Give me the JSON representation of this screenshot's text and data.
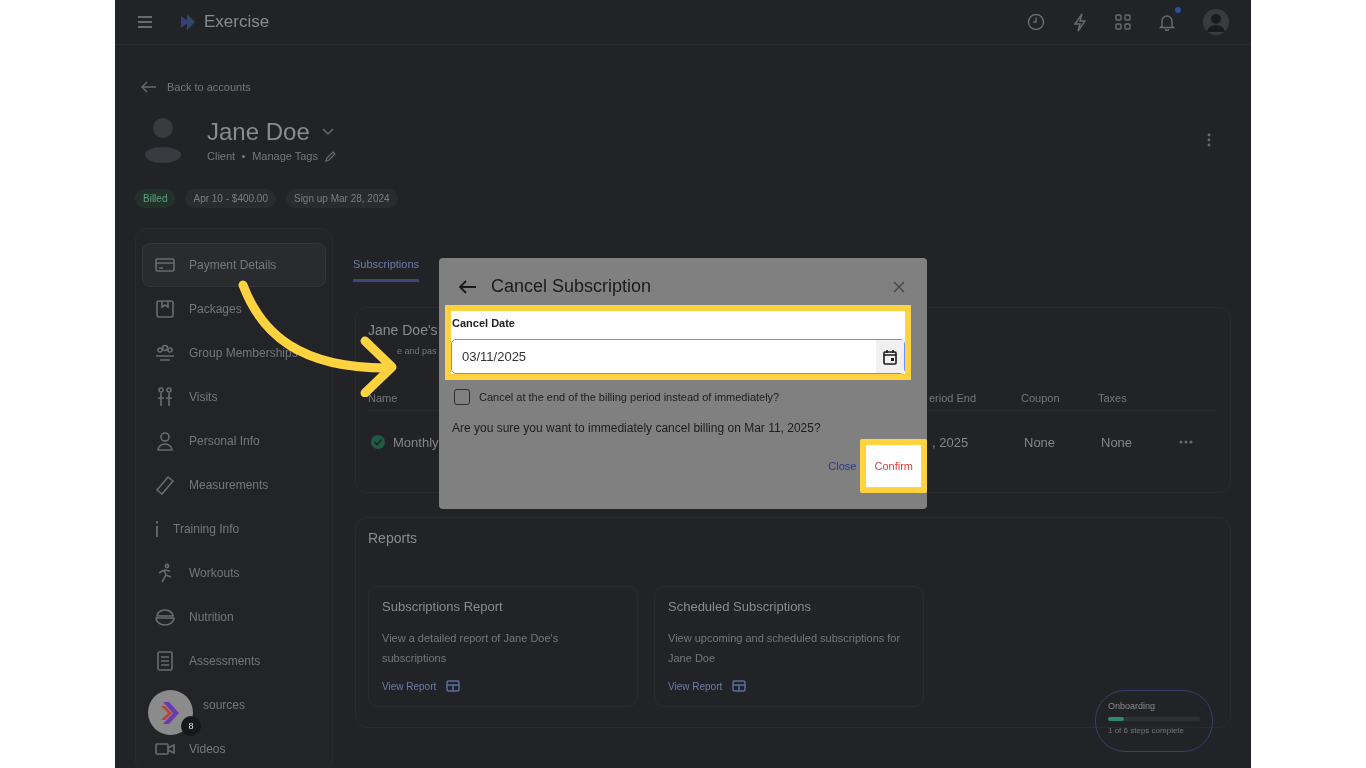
{
  "topbar": {
    "app_name": "Exercise",
    "unread_notifications": true
  },
  "back_link": "Back to accounts",
  "profile": {
    "name": "Jane Doe",
    "role": "Client",
    "tags_link": "Manage Tags",
    "chips": [
      {
        "label": "Billed",
        "kind": "status"
      },
      {
        "label": "Apr 10 - $400.00",
        "kind": "plain"
      },
      {
        "label": "Sign up Mar 28, 2024",
        "kind": "plain"
      }
    ]
  },
  "sidebar": {
    "items": [
      {
        "label": "Payment Details",
        "selected": true
      },
      {
        "label": "Packages",
        "selected": false
      },
      {
        "label": "Group Memberships",
        "selected": false
      },
      {
        "label": "Visits",
        "selected": false
      },
      {
        "label": "Personal Info",
        "selected": false
      },
      {
        "label": "Measurements",
        "selected": false
      },
      {
        "label": "Training Info",
        "selected": false
      },
      {
        "label": "Workouts",
        "selected": false
      },
      {
        "label": "Nutrition",
        "selected": false
      },
      {
        "label": "Assessments",
        "selected": false
      },
      {
        "label": "sources",
        "selected": false
      },
      {
        "label": "Videos",
        "selected": false
      }
    ]
  },
  "tabs": [
    {
      "label": "Subscriptions",
      "selected": true
    }
  ],
  "subscriptions_card": {
    "title": "Jane Doe's",
    "subtitle": "e and pas",
    "columns": [
      "Name",
      "eriod End",
      "Coupon",
      "Taxes"
    ],
    "rows": [
      {
        "name": "Monthly",
        "period_end": ", 2025",
        "coupon": "None",
        "taxes": "None",
        "active": true
      }
    ]
  },
  "reports": {
    "title": "Reports",
    "cards": [
      {
        "title": "Subscriptions Report",
        "description": "View a detailed report of Jane Doe's subscriptions",
        "link": "View Report"
      },
      {
        "title": "Scheduled Subscriptions",
        "description": "View upcoming and scheduled subscriptions for Jane Doe",
        "link": "View Report"
      }
    ]
  },
  "onboarding": {
    "title": "Onboarding",
    "level": 0.17,
    "progress_text": "1 of 6 steps complete"
  },
  "help_widget": {
    "badge": "8"
  },
  "dialog": {
    "title": "Cancel Subscription",
    "field": {
      "label": "Cancel Date",
      "value": "03/11/2025",
      "highlighted": true
    },
    "option": {
      "label": "Cancel at the end of the billing period instead of immediately?",
      "checked": false
    },
    "message": "Are you sure you want to immediately cancel billing on Mar 11, 2025?",
    "buttons": [
      {
        "label": "Close",
        "kind": "link",
        "highlighted": false
      },
      {
        "label": "Confirm",
        "kind": "primary",
        "highlighted": true
      }
    ]
  }
}
